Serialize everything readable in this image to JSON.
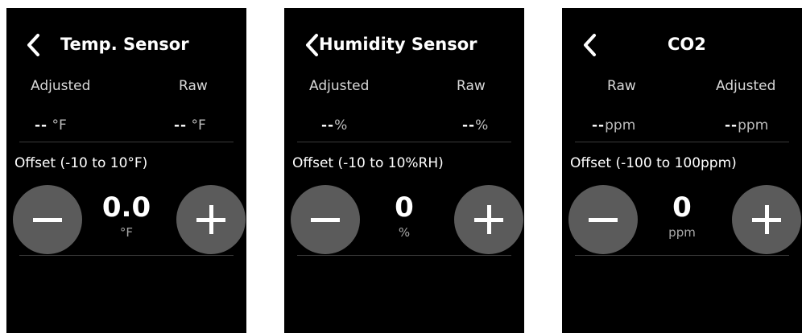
{
  "screens": [
    {
      "title": "Temp. Sensor",
      "col_left": "Adjusted",
      "col_right": "Raw",
      "val_left": "--",
      "val_left_unit": " °F",
      "val_right": "--",
      "val_right_unit": " °F",
      "offset_label": "Offset (-10 to 10°F)",
      "value": "0.0",
      "unit": "°F"
    },
    {
      "title": "Humidity Sensor",
      "col_left": "Adjusted",
      "col_right": "Raw",
      "val_left": "--",
      "val_left_unit": "%",
      "val_right": "--",
      "val_right_unit": "%",
      "offset_label": "Offset (-10 to 10%RH)",
      "value": "0",
      "unit": "%"
    },
    {
      "title": "CO2",
      "col_left": "Raw",
      "col_right": "Adjusted",
      "val_left": "--",
      "val_left_unit": "ppm",
      "val_right": "--",
      "val_right_unit": "ppm",
      "offset_label": "Offset (-100 to 100ppm)",
      "value": "0",
      "unit": "ppm"
    }
  ],
  "colors": {
    "background": "#000000",
    "button": "#5b5b5b",
    "text": "#ffffff",
    "muted_text": "#bdbdbd",
    "divider": "#3a3a3a"
  },
  "icons": {
    "back": "chevron-left-icon",
    "decrement": "minus-icon",
    "increment": "plus-icon"
  }
}
